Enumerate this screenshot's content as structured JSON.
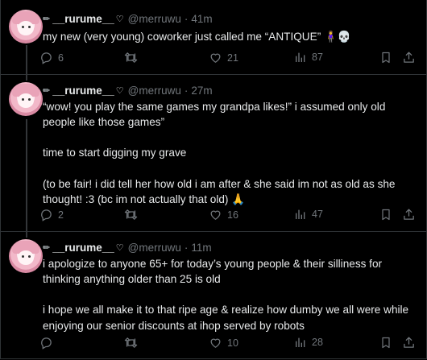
{
  "tweets": [
    {
      "display_name": "__rurume__",
      "handle": "@merruwu",
      "separator": "·",
      "time": "41m",
      "text": [
        "my new (very young) coworker just called me “ANTIQUE” 🧍‍♀️💀"
      ],
      "replies": "6",
      "retweets": "",
      "likes": "21",
      "views": "87"
    },
    {
      "display_name": "__rurume__",
      "handle": "@merruwu",
      "separator": "·",
      "time": "27m",
      "text": [
        "“wow! you play the same games my grandpa likes!” i assumed only old people like those games”",
        "",
        "time to start digging my grave",
        "",
        "(to be fair! i did tell her how old i am after & she said im not as old as she thought! :3 (bc im not actually that old) 🙏"
      ],
      "replies": "2",
      "retweets": "",
      "likes": "16",
      "views": "47"
    },
    {
      "display_name": "__rurume__",
      "handle": "@merruwu",
      "separator": "·",
      "time": "11m",
      "text": [
        "i apologize to anyone 65+ for today’s young people & their silliness for thinking anything older than 25 is old",
        "",
        "i hope we all make it to that ripe age & realize how dumby we all were while enjoying our senior discounts at ihop served by robots"
      ],
      "replies": "",
      "retweets": "",
      "likes": "10",
      "views": "28"
    }
  ],
  "icons": {
    "pencil": "✏",
    "verified_heart": "♡",
    "reply": "reply-icon",
    "retweet": "retweet-icon",
    "like": "heart-icon",
    "views": "views-icon",
    "bookmark": "bookmark-icon",
    "share": "share-icon"
  },
  "colors": {
    "background": "#000000",
    "text": "#e7e9ea",
    "muted": "#71767b",
    "divider": "#2f3336"
  }
}
